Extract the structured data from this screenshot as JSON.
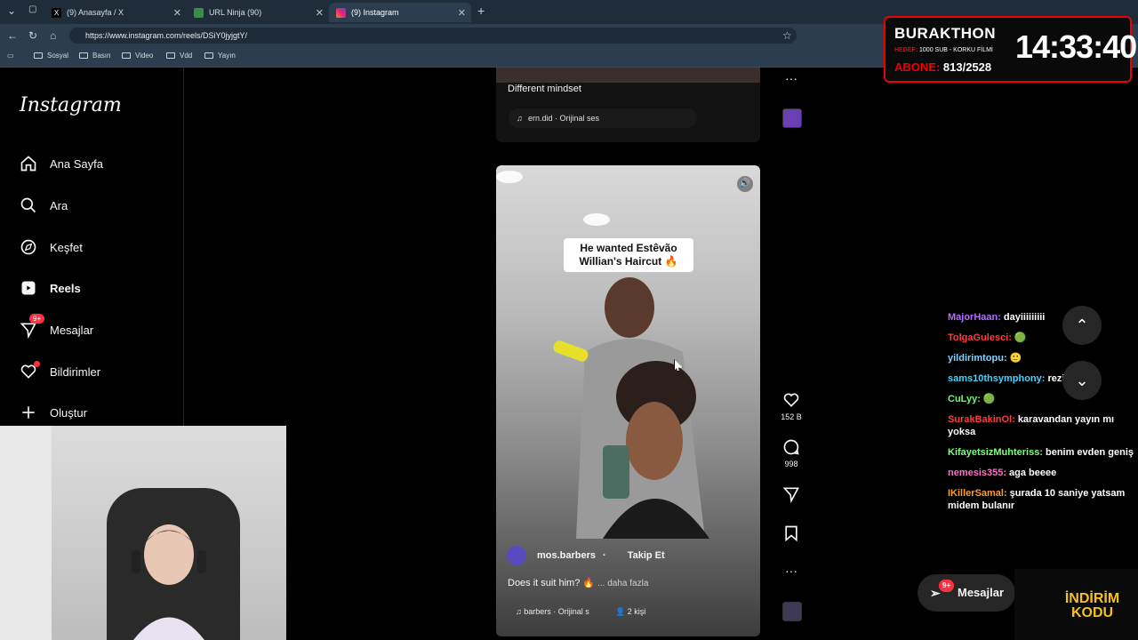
{
  "browser": {
    "tabs": [
      {
        "label": "(9) Anasayfa / X",
        "icon": "x-logo-icon"
      },
      {
        "label": "URL Ninja (90)",
        "icon": "ninja-icon"
      },
      {
        "label": "(9) Instagram",
        "icon": "instagram-icon"
      }
    ],
    "url": "https://www.instagram.com/reels/DSiY0jyjgtY/",
    "bookmarks": [
      "Sosyal",
      "Basın",
      "Video",
      "Vdd",
      "Yayın"
    ]
  },
  "sidebar": {
    "logo": "Instagram",
    "items": [
      {
        "label": "Ana Sayfa",
        "icon": "home-icon"
      },
      {
        "label": "Ara",
        "icon": "search-icon"
      },
      {
        "label": "Keşfet",
        "icon": "compass-icon"
      },
      {
        "label": "Reels",
        "icon": "reels-icon"
      },
      {
        "label": "Mesajlar",
        "icon": "messenger-icon",
        "badge": "9+"
      },
      {
        "label": "Bildirimler",
        "icon": "heart-icon"
      },
      {
        "label": "Oluştur",
        "icon": "plus-icon"
      }
    ]
  },
  "reel_previous": {
    "caption": "Different mindset",
    "audio": "ern.did · Orijinal ses"
  },
  "reel_current": {
    "overlay_text": "He wanted Estêvão Willian's Haircut 🔥",
    "author": "mos.barbers",
    "follow": "Takip Et",
    "caption": "Does it suit him? 🔥",
    "more": "... daha fazla",
    "audio": "barbers · Orijinal s",
    "people": "2 kişi"
  },
  "actions": {
    "likes": "152 B",
    "comments": "998"
  },
  "stream": {
    "title": "BURAKTHON",
    "goal_label": "HEDEF:",
    "goal": "1000 SUB - KORKU FİLMİ",
    "abone_label": "ABONE:",
    "abone_value": "813/2528",
    "time": "14:33:40"
  },
  "chat": [
    {
      "user": "MajorHaan:",
      "msg": "dayiiiiiiiii",
      "color": "#b36cff"
    },
    {
      "user": "TolgaGulesci:",
      "msg": "🟢",
      "color": "#ff3b3b"
    },
    {
      "user": "yildirimtopu:",
      "msg": "🙂",
      "color": "#7fd3ff"
    },
    {
      "user": "sams10thsymphony:",
      "msg": "rezil hayat",
      "color": "#3dd6ff"
    },
    {
      "user": "CuLyy:",
      "msg": "🟢",
      "color": "#6aff6a"
    },
    {
      "user": "SurakBakinOl:",
      "msg": "karavandan yayın mı yoksa",
      "color": "#ff3b3b"
    },
    {
      "user": "KifayetsizMuhteriss:",
      "msg": "benim evden geniş",
      "color": "#7dff7d"
    },
    {
      "user": "nemesis355:",
      "msg": "aga beeee",
      "color": "#ff6ec7"
    },
    {
      "user": "IKillerSamal:",
      "msg": "şurada 10 saniye yatsam midem bulanır",
      "color": "#ff9a2e"
    }
  ],
  "messages_pill": {
    "label": "Mesajlar",
    "badge": "9+"
  },
  "promo": {
    "text": "İNDİRİM KODU"
  }
}
